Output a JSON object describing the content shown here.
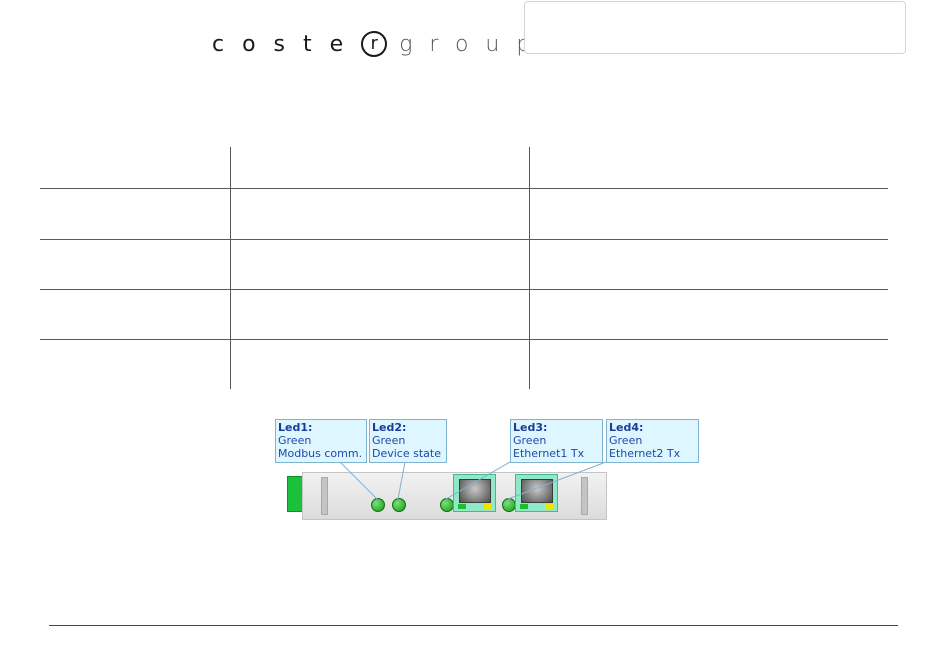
{
  "logo": {
    "dark": "coste",
    "mark": "r",
    "light": "group"
  },
  "leds": [
    {
      "title": "Led1:",
      "color": "Green",
      "desc": "Modbus comm."
    },
    {
      "title": "Led2:",
      "color": "Green",
      "desc": "Device state"
    },
    {
      "title": "Led3:",
      "color": "Green",
      "desc": "Ethernet1 Tx"
    },
    {
      "title": "Led4:",
      "color": "Green",
      "desc": "Ethernet2 Tx"
    }
  ],
  "colors": {
    "callout_bg": "#ddf6ff",
    "callout_text": "#1f4aa8",
    "led_green": "#149a14",
    "connector_green": "#19c23a",
    "port_teal": "#8fe8c8",
    "footer_rule": "#1e5560"
  }
}
